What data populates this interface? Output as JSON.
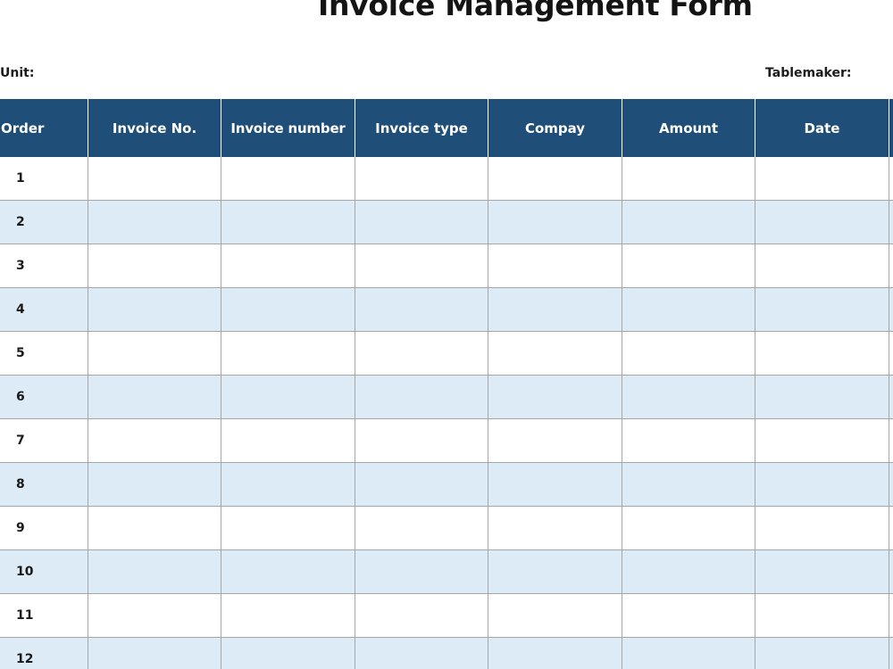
{
  "form": {
    "title": "Invoice Management Form",
    "unit_label": "Unit:",
    "tablemaker_label": "Tablemaker:"
  },
  "table": {
    "columns": [
      "Order",
      "Invoice No.",
      "Invoice number",
      "Invoice type",
      "Compay",
      "Amount",
      "Date"
    ],
    "rows": [
      "1",
      "2",
      "3",
      "4",
      "5",
      "6",
      "7",
      "8",
      "9",
      "10",
      "11",
      "12"
    ]
  },
  "colors": {
    "header_bg": "#1f4e79",
    "header_text": "#ffffff",
    "alt_row_bg": "#ddebf7",
    "grid_line": "#a6a6a6"
  }
}
